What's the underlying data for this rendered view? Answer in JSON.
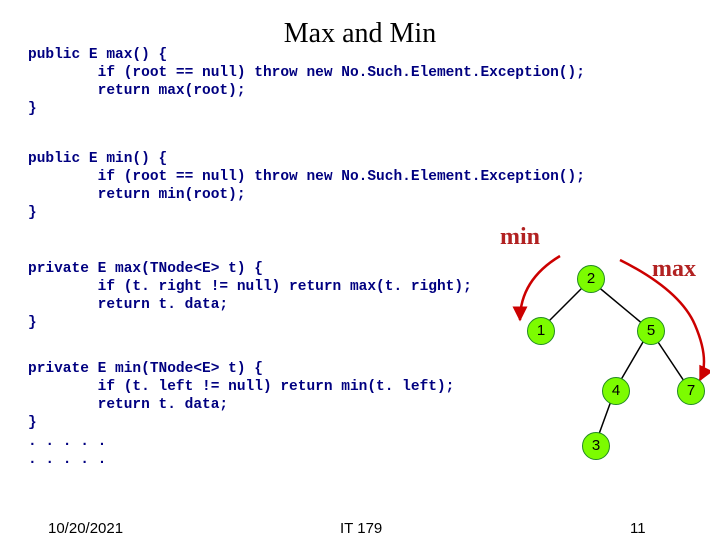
{
  "title": "Max and Min",
  "code": {
    "block1": "public E max() {\n        if (root == null) throw new No.Such.Element.Exception();\n        return max(root);\n}",
    "block2": "public E min() {\n        if (root == null) throw new No.Such.Element.Exception();\n        return min(root);\n}",
    "block3": "private E max(TNode<E> t) {\n        if (t. right != null) return max(t. right);\n        return t. data;\n}",
    "block4": "private E min(TNode<E> t) {\n        if (t. left != null) return min(t. left);\n        return t. data;\n}\n. . . . .\n. . . . ."
  },
  "labels": {
    "min": "min",
    "max": "max"
  },
  "tree": {
    "n2": "2",
    "n1": "1",
    "n5": "5",
    "n4": "4",
    "n7": "7",
    "n3": "3"
  },
  "footer": {
    "date": "10/20/2021",
    "course": "IT 179",
    "page": "11"
  },
  "chart_data": {
    "type": "table",
    "title": "Binary search tree node values",
    "nodes": [
      {
        "value": 2,
        "parent": null
      },
      {
        "value": 1,
        "parent": 2
      },
      {
        "value": 5,
        "parent": 2
      },
      {
        "value": 4,
        "parent": 5
      },
      {
        "value": 7,
        "parent": 5
      },
      {
        "value": 3,
        "parent": 4
      }
    ],
    "min_path": [
      2,
      1
    ],
    "max_path": [
      2,
      5,
      7
    ]
  }
}
